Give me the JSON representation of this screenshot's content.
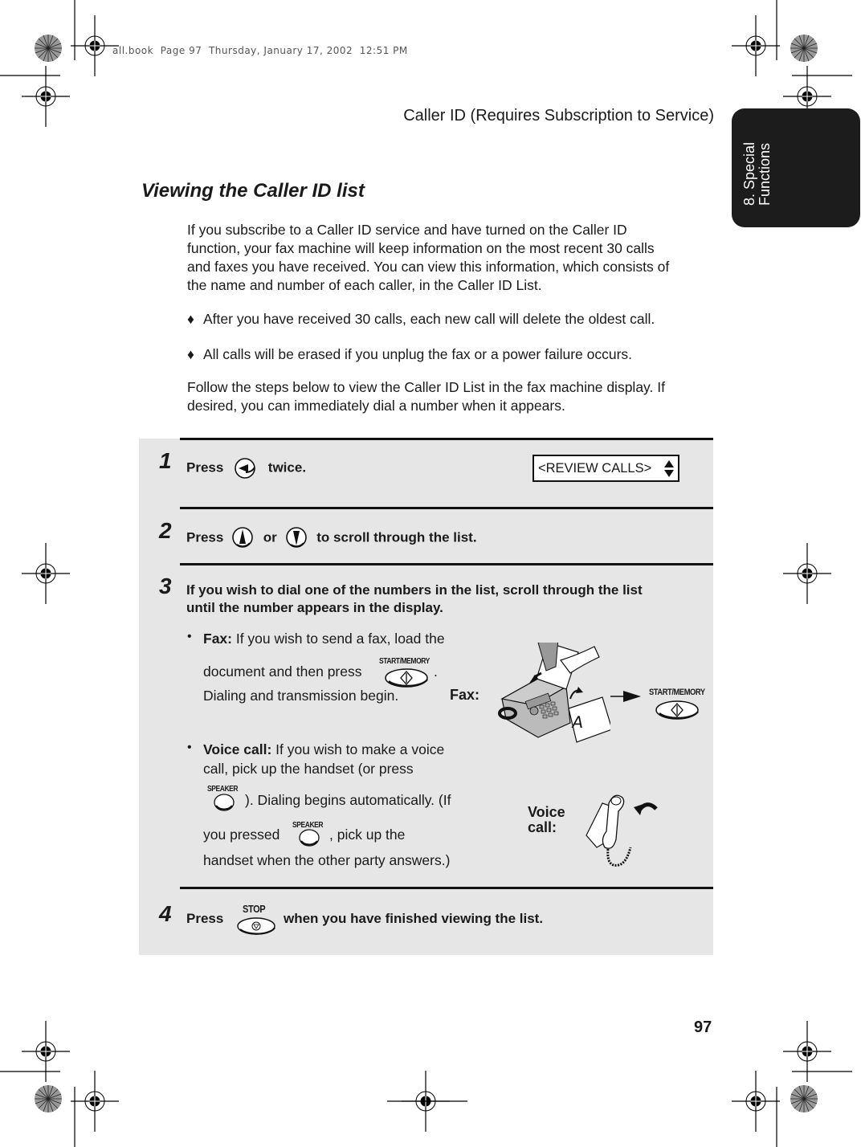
{
  "slug": "all.book  Page 97  Thursday, January 17, 2002  12:51 PM",
  "running_head": "Caller ID (Requires Subscription to Service)",
  "chapter_tab": {
    "line1": "8. Special",
    "line2": "Functions"
  },
  "section_title": "Viewing the Caller ID list",
  "intro_paragraph": [
    "If you subscribe to a Caller ID service and have turned on the Caller ID",
    "function, your fax machine will keep information on the most recent 30 calls",
    "and faxes you have received. You can view this information, which consists of",
    "the name and number of each caller, in the Caller ID List."
  ],
  "bullets": [
    {
      "symbol": "♦",
      "text": "After you have received 30 calls, each new call will delete the oldest call."
    },
    {
      "symbol": "♦",
      "text": "All calls will be erased if you unplug the fax or a power failure occurs."
    }
  ],
  "follow_paragraph": [
    "Follow the steps below to view the Caller ID List in the fax machine display. If",
    "desired, you can immediately dial a number when it appears."
  ],
  "steps": [
    {
      "num": "1",
      "before": "Press",
      "after": "twice.",
      "key_icon": "left-arrow-key-icon"
    },
    {
      "num": "2",
      "before": "Press",
      "mid": "or",
      "after": "to  scroll through the list.",
      "key_icons": [
        "up-arrow-key-icon",
        "down-arrow-key-icon"
      ]
    },
    {
      "num": "3",
      "lines": [
        "If you wish to dial one of the numbers in the list, scroll through the list",
        "until the number appears in the display."
      ]
    },
    {
      "num": "4",
      "before": "Press",
      "after": "when you have finished viewing the list.",
      "key_label": "STOP"
    }
  ],
  "lcd_display": {
    "text": "<REVIEW CALLS>",
    "icon": "up-down-arrows-icon"
  },
  "fax_sub": {
    "bullet": "•",
    "label": "Fax:",
    "line1_rest": " If you wish to send a fax, load the",
    "line2": "document and then press",
    "line2_end": ".",
    "line3": "Dialing and transmission begin.",
    "key_label": "START/MEMORY"
  },
  "voice_sub": {
    "bullet": "•",
    "label": "Voice call:",
    "line1_rest": " If you wish to make a voice",
    "line2": "call, pick up the handset (or press",
    "line3": "). Dialing begins automatically. (If",
    "line4a": "you pressed",
    "line4b": ", pick up the",
    "line5": "handset when the other party answers.)",
    "key_label": "SPEAKER"
  },
  "figures": {
    "fax_label": "Fax:",
    "fax_key_label": "START/MEMORY",
    "voice_label_1": "Voice",
    "voice_label_2": "call:"
  },
  "page_number": "97"
}
